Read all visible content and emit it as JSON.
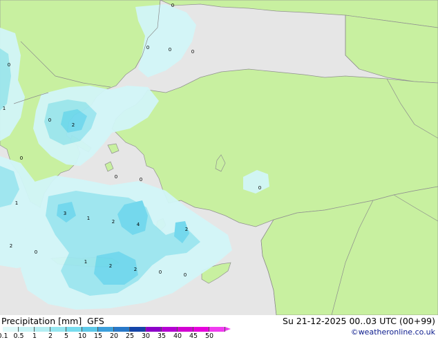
{
  "colors": {
    "sea_dry": "#e6e6e6",
    "land": "#c8f0a0",
    "border": "#8c8c8c",
    "coast": "#909090"
  },
  "footer": {
    "title": "Precipitation [mm]  GFS",
    "datetime": "Su 21-12-2025 00..03 UTC (00+99)",
    "credit": "©weatheronline.co.uk"
  },
  "legend": {
    "labels": [
      "0.1",
      "0.5",
      "1",
      "2",
      "5",
      "10",
      "15",
      "20",
      "25",
      "30",
      "35",
      "40",
      "45",
      "50"
    ],
    "colors": [
      "#e0fafa",
      "#c8f4f6",
      "#b4eef2",
      "#96e6f0",
      "#78dcee",
      "#5cc8e8",
      "#3ca0dc",
      "#2878c8",
      "#1444a8",
      "#8c00c8",
      "#b400d2",
      "#d200d2",
      "#e600dc",
      "#f03cf0"
    ]
  },
  "map_values": [
    "0",
    "0",
    "0",
    "0",
    "0",
    "1",
    "0",
    "2",
    "0",
    "1",
    "3",
    "1",
    "2",
    "4",
    "2",
    "0",
    "0",
    "0",
    "2",
    "0",
    "1",
    "2",
    "2",
    "0",
    "0"
  ]
}
